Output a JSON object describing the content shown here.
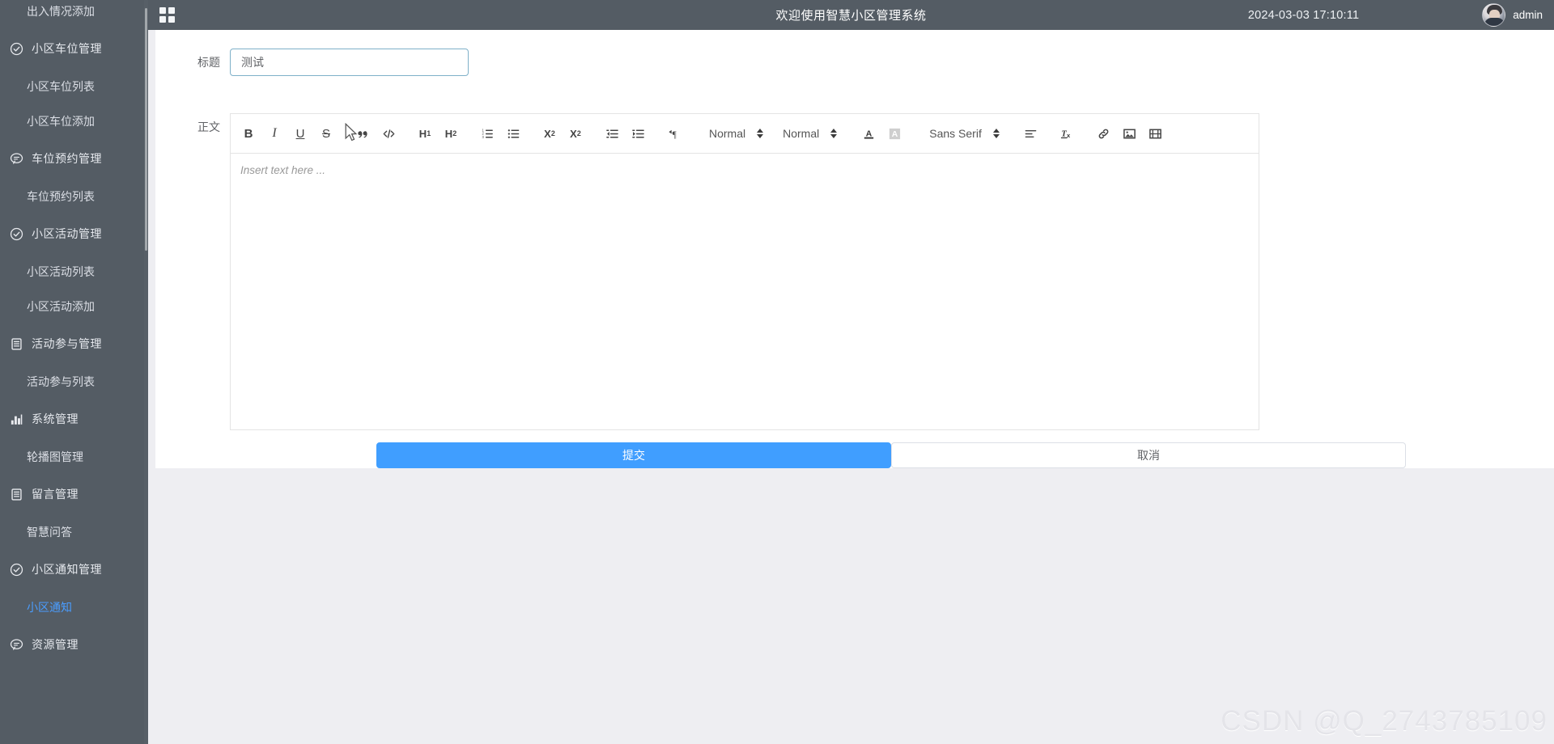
{
  "header": {
    "title": "欢迎使用智慧小区管理系统",
    "datetime": "2024-03-03 17:10:11",
    "username": "admin",
    "grid_toggle_icon": "grid-toggle-icon",
    "avatar_icon": "avatar"
  },
  "sidebar": {
    "items": [
      {
        "label": "出入情况添加",
        "type": "child",
        "icon": "",
        "active": false
      },
      {
        "label": "小区车位管理",
        "type": "parent",
        "icon": "check-circle-icon",
        "active": false
      },
      {
        "label": "小区车位列表",
        "type": "child",
        "icon": "",
        "active": false
      },
      {
        "label": "小区车位添加",
        "type": "child",
        "icon": "",
        "active": false
      },
      {
        "label": "车位预约管理",
        "type": "parent",
        "icon": "chat-bubble-icon",
        "active": false
      },
      {
        "label": "车位预约列表",
        "type": "child",
        "icon": "",
        "active": false
      },
      {
        "label": "小区活动管理",
        "type": "parent",
        "icon": "check-circle-icon",
        "active": false
      },
      {
        "label": "小区活动列表",
        "type": "child",
        "icon": "",
        "active": false
      },
      {
        "label": "小区活动添加",
        "type": "child",
        "icon": "",
        "active": false
      },
      {
        "label": "活动参与管理",
        "type": "parent",
        "icon": "document-icon",
        "active": false
      },
      {
        "label": "活动参与列表",
        "type": "child",
        "icon": "",
        "active": false
      },
      {
        "label": "系统管理",
        "type": "parent",
        "icon": "bar-chart-icon",
        "active": false
      },
      {
        "label": "轮播图管理",
        "type": "child",
        "icon": "",
        "active": false
      },
      {
        "label": "留言管理",
        "type": "parent",
        "icon": "document-icon",
        "active": false
      },
      {
        "label": "智慧问答",
        "type": "child",
        "icon": "",
        "active": false
      },
      {
        "label": "小区通知管理",
        "type": "parent",
        "icon": "check-circle-icon",
        "active": false
      },
      {
        "label": "小区通知",
        "type": "child",
        "icon": "",
        "active": true
      },
      {
        "label": "资源管理",
        "type": "parent",
        "icon": "chat-bubble-icon",
        "active": false
      }
    ]
  },
  "form": {
    "title_label": "标题",
    "title_value": "测试",
    "title_placeholder": "",
    "body_label": "正文",
    "editor_placeholder": "Insert text here ...",
    "submit_label": "提交",
    "cancel_label": "取消"
  },
  "editor_toolbar": {
    "buttons": [
      {
        "name": "bold-icon",
        "label": "B"
      },
      {
        "name": "italic-icon",
        "label": "I"
      },
      {
        "name": "underline-icon",
        "label": "U"
      },
      {
        "name": "strike-icon",
        "label": "S"
      },
      {
        "name": "blockquote-icon",
        "label": "”"
      },
      {
        "name": "code-block-icon",
        "label": "</>"
      },
      {
        "name": "header-1-icon",
        "label": "H1"
      },
      {
        "name": "header-2-icon",
        "label": "H2"
      },
      {
        "name": "ordered-list-icon",
        "label": ""
      },
      {
        "name": "bullet-list-icon",
        "label": ""
      },
      {
        "name": "subscript-icon",
        "label": "X2"
      },
      {
        "name": "superscript-icon",
        "label": "X2"
      },
      {
        "name": "outdent-icon",
        "label": ""
      },
      {
        "name": "indent-icon",
        "label": ""
      },
      {
        "name": "text-direction-icon",
        "label": "¶"
      },
      {
        "name": "font-color-icon",
        "label": "A"
      },
      {
        "name": "background-color-icon",
        "label": "A"
      },
      {
        "name": "align-icon",
        "label": ""
      },
      {
        "name": "clear-format-icon",
        "label": "Tx"
      },
      {
        "name": "link-icon",
        "label": ""
      },
      {
        "name": "image-icon",
        "label": ""
      },
      {
        "name": "video-icon",
        "label": ""
      }
    ],
    "pickers": [
      {
        "name": "header-picker",
        "value": "Normal"
      },
      {
        "name": "size-picker",
        "value": "Normal"
      },
      {
        "name": "font-picker",
        "value": "Sans Serif"
      }
    ]
  },
  "watermark": "CSDN @Q_2743785109"
}
